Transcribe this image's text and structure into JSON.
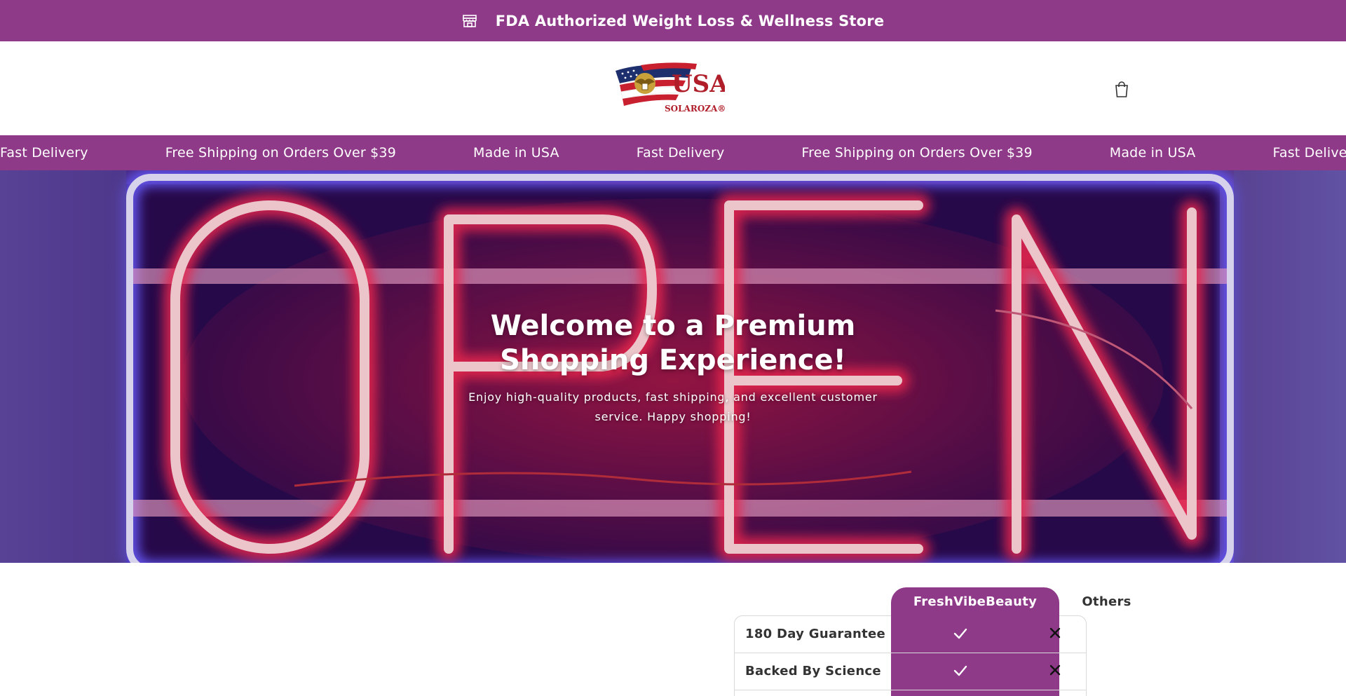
{
  "announcement": {
    "icon": "storefront-icon",
    "text": "FDA Authorized Weight Loss & Wellness Store"
  },
  "header": {
    "logo": {
      "icon": "usa-flag-eagle-logo",
      "wordmark": "USA",
      "brand": "SOLAROZA®"
    },
    "cart_icon": "shopping-bag-icon"
  },
  "marquee": {
    "items": [
      "Fast Delivery",
      "Free Shipping on Orders Over $39",
      "Made in USA",
      "Fast Delivery",
      "Free Shipping on Orders Over $39",
      "Made in USA",
      "Fast Delivery"
    ]
  },
  "hero": {
    "background": "neon-open-sign",
    "title": "Welcome to a Premium Shopping Experience!",
    "subtitle": "Enjoy high-quality products, fast shipping, and excellent customer service. Happy shopping!"
  },
  "comparison": {
    "brand_header": "FreshVibeBeauty",
    "others_header": "Others",
    "rows": [
      {
        "label": "180 Day Guarantee",
        "brand": "check-icon",
        "others": "x-icon"
      },
      {
        "label": "Backed By Science",
        "brand": "check-icon",
        "others": "x-icon"
      }
    ]
  },
  "colors": {
    "brand_purple": "#8e3a88",
    "white": "#ffffff",
    "neon_red": "#ff4466",
    "neon_blue": "#5a4cff"
  }
}
